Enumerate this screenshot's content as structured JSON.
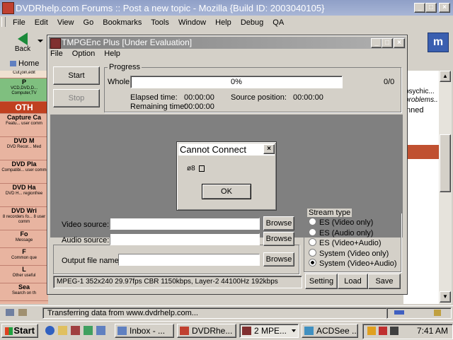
{
  "browser": {
    "title": "DVDRhelp.com Forums :: Post a new topic - Mozilla {Build ID: 2003040105}",
    "menu": [
      "File",
      "Edit",
      "View",
      "Go",
      "Bookmarks",
      "Tools",
      "Window",
      "Help",
      "Debug",
      "QA"
    ],
    "back_label": "Back",
    "home_label": "Home",
    "status_text": "Transferring data from www.dvdrhelp.com...",
    "page_snippets": [
      "problems..",
      "psychic...",
      "nned"
    ]
  },
  "sidebar": {
    "sections": [
      {
        "title": "",
        "sub": "Cut,join,edit"
      },
      {
        "title": "P",
        "sub": "VCD,DVD,D... Computer,TV"
      },
      {
        "title": "OTH",
        "sub": ""
      },
      {
        "title": "Capture Ca",
        "sub": "Featu... user comm"
      },
      {
        "title": "DVD M",
        "sub": "DVD Recor... Med"
      },
      {
        "title": "DVD Pla",
        "sub": "Compatibi... user comm"
      },
      {
        "title": "DVD Ha",
        "sub": "DVD H... regionfree"
      },
      {
        "title": "DVD Wri",
        "sub": "8 recorders fo... 8 user comm"
      },
      {
        "title": "Fo",
        "sub": "Message"
      },
      {
        "title": "F",
        "sub": "Common que"
      },
      {
        "title": "L",
        "sub": "Other useful"
      },
      {
        "title": "Sea",
        "sub": "Search on th"
      }
    ]
  },
  "tmpgenc": {
    "title": "TMPGEnc Plus [Under Evaluation]",
    "menu": [
      "File",
      "Option",
      "Help"
    ],
    "start_label": "Start",
    "stop_label": "Stop",
    "progress_group": "Progress",
    "whole_label": "Whole:",
    "whole_percent": "0%",
    "progress_fraction": 0,
    "count": "0/0",
    "elapsed_label": "Elapsed time:",
    "elapsed_value": "00:00:00",
    "remaining_label": "Remaining time:",
    "remaining_value": "00:00:00",
    "source_pos_label": "Source position:",
    "source_pos_value": "00:00:00",
    "video_source_label": "Video source:",
    "audio_source_label": "Audio source:",
    "output_label": "Output file name:",
    "video_source_value": "",
    "audio_source_value": "",
    "output_value": "",
    "browse_label": "Browse",
    "stream_type_label": "Stream type",
    "stream_options": [
      "ES (Video only)",
      "ES (Audio only)",
      "ES (Video+Audio)",
      "System (Video only)",
      "System (Video+Audio)"
    ],
    "stream_selected": 4,
    "encode_info": "MPEG-1 352x240 29.97fps CBR 1150kbps,  Layer-2 44100Hz 192kbps",
    "setting_label": "Setting",
    "load_label": "Load",
    "save_label": "Save"
  },
  "dialog": {
    "title": "Cannot Connect",
    "message": "ø8",
    "ok_label": "OK"
  },
  "taskbar": {
    "start_label": "Start",
    "tasks": [
      "Inbox - ...",
      "DVDRhe...",
      "2 MPE...",
      "ACDSee ..."
    ],
    "clock": "7:41 AM"
  },
  "colors": {
    "sidebar_bg": "#e8b4a0",
    "section_header": "#c04020",
    "section_header_green": "#7fbf7f",
    "tmp_title_inactive": "#808080",
    "dialog_title_bg": "#ffffff"
  }
}
